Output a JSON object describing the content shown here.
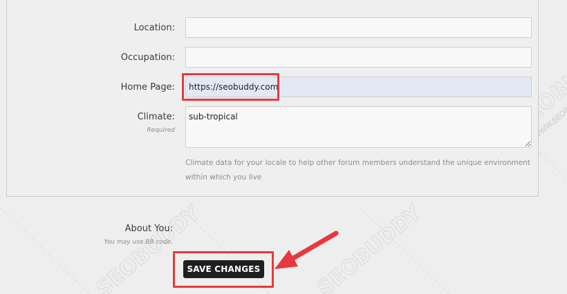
{
  "fields": {
    "location": {
      "label": "Location:",
      "value": ""
    },
    "occupation": {
      "label": "Occupation:",
      "value": ""
    },
    "homepage": {
      "label": "Home Page:",
      "value": "https://seobuddy.com"
    },
    "climate": {
      "label": "Climate:",
      "required": "Required",
      "value": "sub-tropical",
      "hint": "Climate data for your locale to help other forum members understand the unique environment within which you live"
    },
    "about": {
      "label": "About You:",
      "hint": "You may use BB code."
    }
  },
  "actions": {
    "save_label": "SAVE CHANGES"
  },
  "watermark": {
    "brand": "SEOBUDDY",
    "url": "WWW.SEOBUDDY.COM"
  },
  "colors": {
    "highlight": "#e8383e",
    "button": "#1f1f1f",
    "filled_input": "#e2e9f5"
  }
}
